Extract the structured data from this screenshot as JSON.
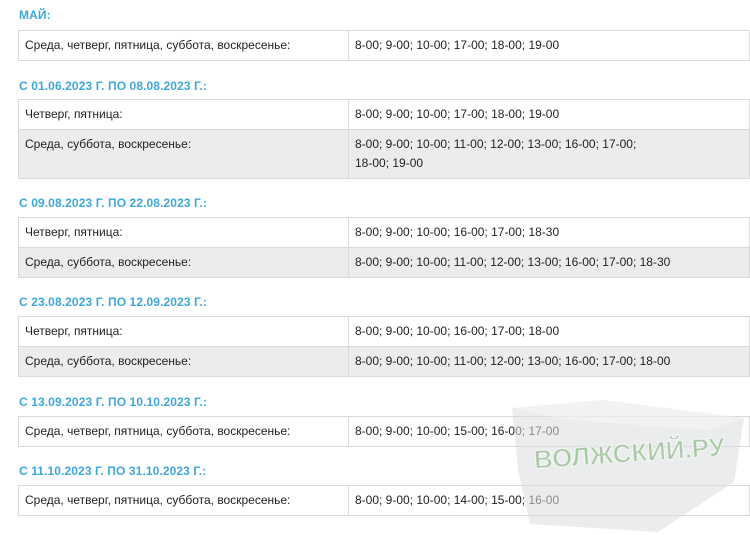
{
  "sections": [
    {
      "title": "МАЙ:",
      "rows": [
        {
          "days": "Среда, четверг, пятница, суббота, воскресенье:",
          "times": "8-00; 9-00; 10-00; 17-00; 18-00; 19-00"
        }
      ]
    },
    {
      "title": "С 01.06.2023 Г. ПО 08.08.2023 Г.:",
      "rows": [
        {
          "days": "Четверг, пятница:",
          "times": "8-00; 9-00; 10-00; 17-00; 18-00; 19-00"
        },
        {
          "days": "Среда, суббота, воскресенье:",
          "times": "8-00; 9-00; 10-00; 11-00; 12-00; 13-00; 16-00; 17-00;",
          "times2": "18-00; 19-00"
        }
      ]
    },
    {
      "title": "С 09.08.2023 Г. ПО 22.08.2023 Г.:",
      "rows": [
        {
          "days": "Четверг, пятница:",
          "times": "8-00; 9-00; 10-00; 16-00; 17-00; 18-30"
        },
        {
          "days": "Среда, суббота, воскресенье:",
          "times": "8-00; 9-00; 10-00; 11-00; 12-00; 13-00; 16-00; 17-00; 18-30"
        }
      ]
    },
    {
      "title": "С 23.08.2023 Г. ПО 12.09.2023 Г.:",
      "rows": [
        {
          "days": "Четверг, пятница:",
          "times": "8-00; 9-00; 10-00; 16-00; 17-00; 18-00"
        },
        {
          "days": "Среда, суббота, воскресенье:",
          "times": "8-00; 9-00; 10-00; 11-00; 12-00; 13-00; 16-00; 17-00; 18-00"
        }
      ]
    },
    {
      "title": "С 13.09.2023 Г. ПО 10.10.2023 Г.:",
      "rows": [
        {
          "days": "Среда, четверг, пятница, суббота, воскресенье:",
          "times": "8-00; 9-00; 10-00; 15-00; 16-00; 17-00"
        }
      ]
    },
    {
      "title": "С 11.10.2023 Г. ПО 31.10.2023 Г.:",
      "rows": [
        {
          "days": "Среда, четверг, пятница, суббота, воскресенье:",
          "times": "8-00; 9-00; 10-00; 14-00; 15-00; 16-00"
        }
      ]
    }
  ],
  "watermark": {
    "text": "ВОЛЖСКИЙ.РУ",
    "color": "#9fc29a"
  },
  "colors": {
    "title": "#3fa7db",
    "alt_row": "#ececec",
    "border": "#d9d9d9"
  }
}
